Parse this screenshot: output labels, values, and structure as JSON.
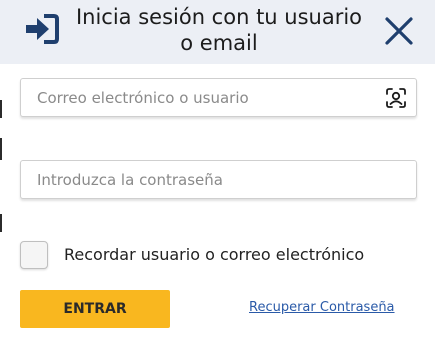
{
  "header": {
    "title_line1": "Inicia sesión con tu usuario",
    "title_line2": "o email",
    "login_icon": "sign-in-icon",
    "close_icon": "close-icon"
  },
  "form": {
    "username": {
      "value": "",
      "placeholder": "Correo electrónico o usuario",
      "icon": "face-scan-icon"
    },
    "password": {
      "value": "",
      "placeholder": "Introduzca la contraseña"
    },
    "remember": {
      "checked": false,
      "label": "Recordar usuario o correo electrónico"
    },
    "submit_label": "ENTRAR",
    "recover_label": "Recuperar Contraseña"
  },
  "colors": {
    "header_bg": "#eceff5",
    "accent_navy": "#1f3f6e",
    "button_yellow": "#f9b71f",
    "link_blue": "#2a5aa8"
  }
}
